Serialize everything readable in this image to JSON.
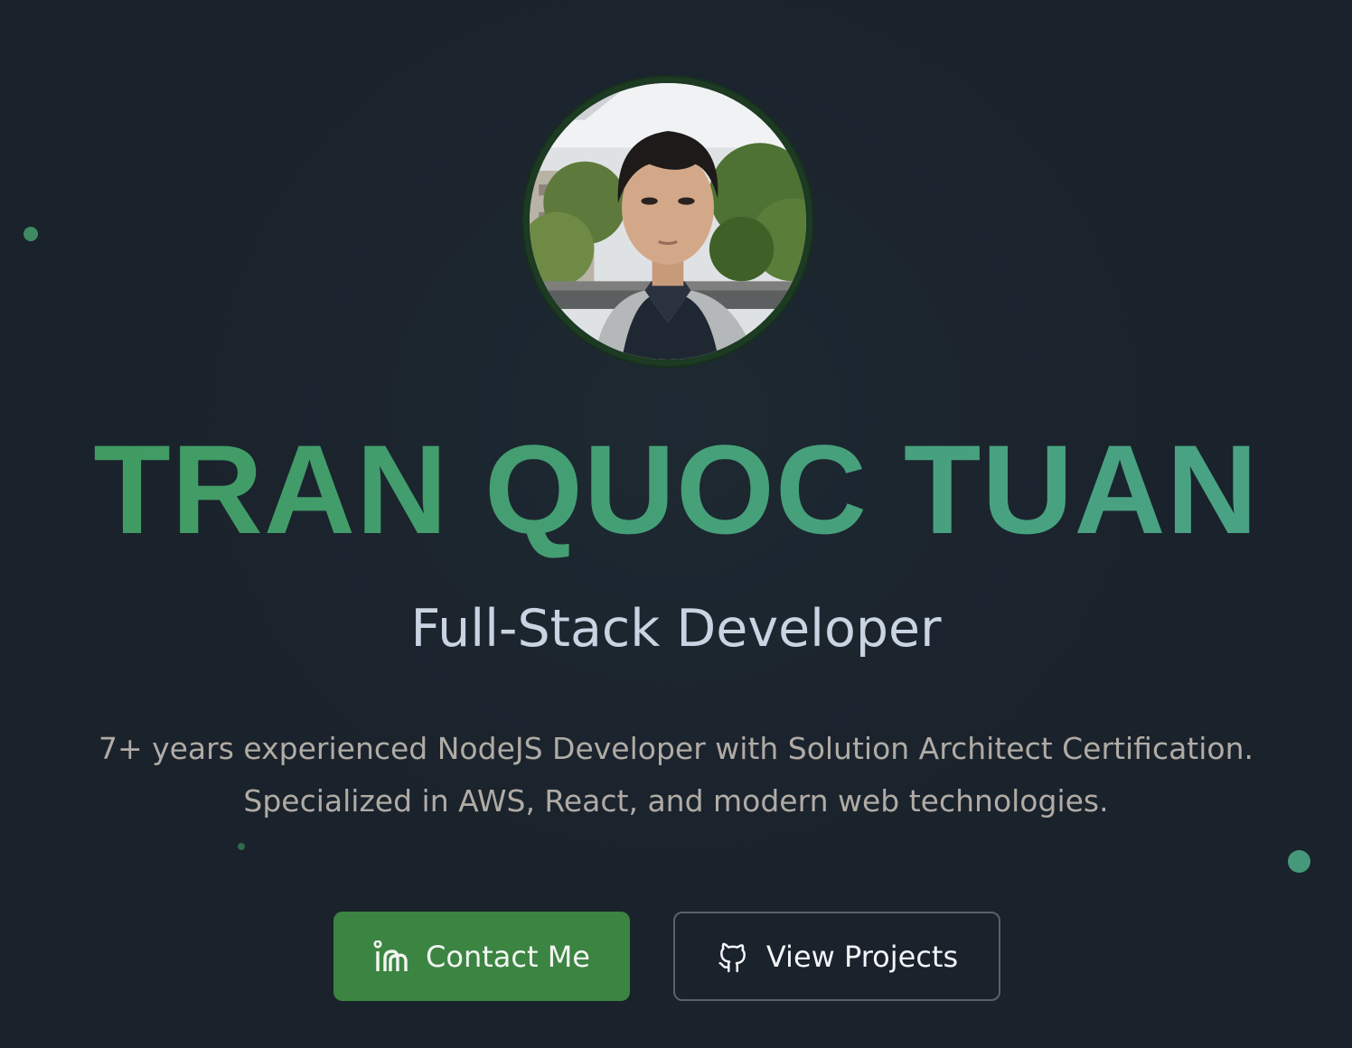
{
  "hero": {
    "avatar": {
      "alt": "profile photo"
    },
    "name": "TRAN QUOC TUAN",
    "role": "Full-Stack Developer",
    "bio_lines": [
      "7+ years experienced NodeJS Developer with Solution Architect Certification.",
      "Specialized in AWS, React, and modern web technologies."
    ]
  },
  "actions": {
    "contact": {
      "label": "Contact Me",
      "icon": "linkedin-icon"
    },
    "projects": {
      "label": "View Projects",
      "icon": "github-icon"
    }
  },
  "colors": {
    "background": "#1a222b",
    "accent_green": "#3c8442",
    "name_gradient_start": "#3f9a5e",
    "name_gradient_end": "#4aa386",
    "role_text": "#c9d3e2",
    "bio_text": "#b0aba5",
    "avatar_ring": "#1d3a22"
  }
}
